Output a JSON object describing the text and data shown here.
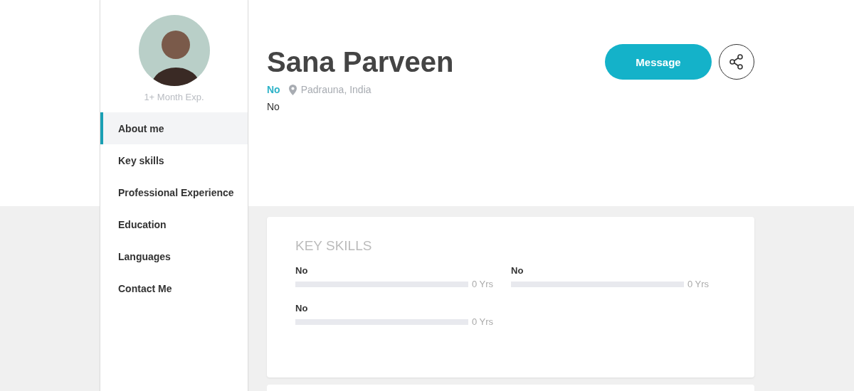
{
  "sidebar": {
    "experience": "1+ Month Exp.",
    "items": [
      {
        "label": "About me",
        "selected": true
      },
      {
        "label": "Key skills",
        "selected": false
      },
      {
        "label": "Professional Experience",
        "selected": false
      },
      {
        "label": "Education",
        "selected": false
      },
      {
        "label": "Languages",
        "selected": false
      },
      {
        "label": "Contact Me",
        "selected": false
      }
    ]
  },
  "profile": {
    "name": "Sana Parveen",
    "tag": "No",
    "location": "Padrauna, India",
    "headline": "No",
    "message_button": "Message"
  },
  "key_skills": {
    "title": "KEY SKILLS",
    "skills": [
      {
        "name": "No",
        "level": 0,
        "years": "0 Yrs"
      },
      {
        "name": "No",
        "level": 0,
        "years": "0 Yrs"
      },
      {
        "name": "No",
        "level": 0,
        "years": "0 Yrs"
      }
    ]
  }
}
